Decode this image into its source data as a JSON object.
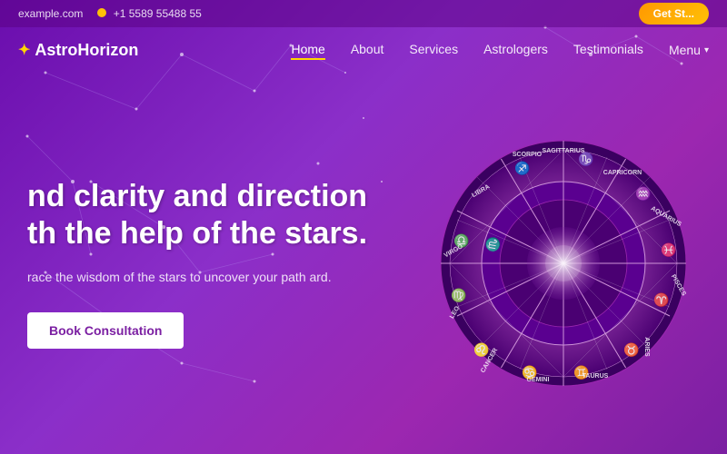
{
  "topbar": {
    "email": "example.com",
    "phone": "+1 5589 55488 55",
    "cta_label": "Get St..."
  },
  "navbar": {
    "logo": "AstroHorizon",
    "logo_icon": "✦",
    "links": [
      {
        "label": "Home",
        "active": true
      },
      {
        "label": "About",
        "active": false
      },
      {
        "label": "Services",
        "active": false
      },
      {
        "label": "Astrologers",
        "active": false
      },
      {
        "label": "Testimonials",
        "active": false
      }
    ],
    "menu_label": "Menu"
  },
  "hero": {
    "title_line1": "nd clarity and direction",
    "title_line2": "th the help of the stars.",
    "subtitle": "race the wisdom of the stars to uncover your path ard.",
    "cta_label": "Book Consultation"
  },
  "zodiac": {
    "signs": [
      "SCORPIO",
      "SAGITTARIUS",
      "CAPRICORN",
      "AQUARIUS",
      "PISCES",
      "ARIES",
      "TAURUS",
      "GEMINI",
      "CANCER",
      "LEO",
      "VIRGO",
      "LIBRA"
    ]
  },
  "colors": {
    "primary": "#8b00cc",
    "accent": "#ffd700",
    "cta_orange": "#ff9800",
    "text_white": "#ffffff"
  }
}
